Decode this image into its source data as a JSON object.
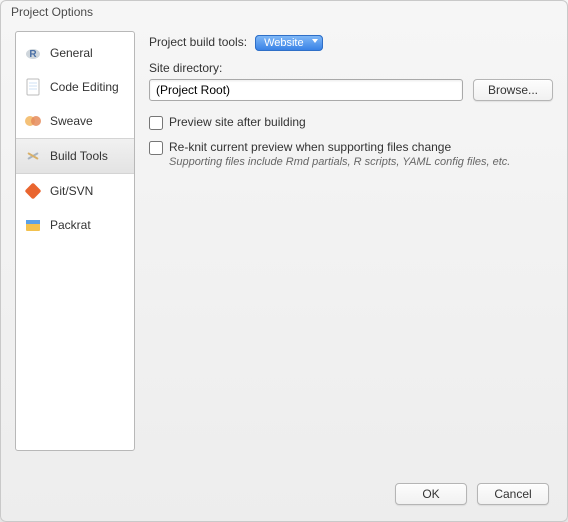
{
  "window": {
    "title": "Project Options"
  },
  "sidebar": {
    "items": [
      {
        "label": "General"
      },
      {
        "label": "Code Editing"
      },
      {
        "label": "Sweave"
      },
      {
        "label": "Build Tools"
      },
      {
        "label": "Git/SVN"
      },
      {
        "label": "Packrat"
      }
    ]
  },
  "main": {
    "build_tools_label": "Project build tools:",
    "build_tools_value": "Website",
    "site_dir_label": "Site directory:",
    "site_dir_value": "(Project Root)",
    "browse_label": "Browse...",
    "preview_label": "Preview site after building",
    "reknit_label": "Re-knit current preview when supporting files change",
    "reknit_hint": "Supporting files include Rmd partials, R scripts, YAML config files, etc."
  },
  "footer": {
    "ok_label": "OK",
    "cancel_label": "Cancel"
  }
}
